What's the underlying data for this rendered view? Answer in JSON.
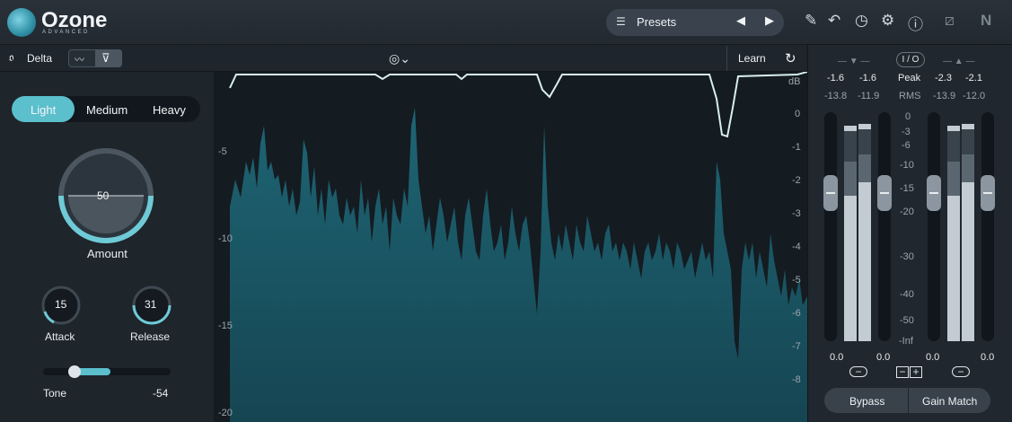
{
  "app": {
    "name": "Ozone",
    "edition": "ADVANCED"
  },
  "header": {
    "presets_label": "Presets",
    "icons": [
      "list-icon",
      "prev-arrow-icon",
      "next-arrow-icon",
      "pencil-icon",
      "undo-icon",
      "history-icon",
      "gear-icon",
      "help-icon",
      "signal-icon",
      "ni-logo"
    ]
  },
  "toolbar": {
    "delta_label": "Delta",
    "learn_label": "Learn"
  },
  "controls": {
    "modes": [
      "Light",
      "Medium",
      "Heavy"
    ],
    "selected_mode": "Light",
    "amount": {
      "label": "Amount",
      "value": "50"
    },
    "attack": {
      "label": "Attack",
      "value": "15"
    },
    "release": {
      "label": "Release",
      "value": "31"
    },
    "tone": {
      "label": "Tone",
      "value": "-54"
    }
  },
  "spectrum": {
    "db_unit": "dB",
    "left_scale": [
      "-5",
      "-10",
      "-15",
      "-20"
    ],
    "right_scale": [
      "0",
      "-1",
      "-2",
      "-3",
      "-4",
      "-5",
      "-6",
      "-7",
      "-8"
    ]
  },
  "meters": {
    "input": {
      "peak_l": "-1.6",
      "peak_r": "-1.6",
      "rms_l": "-13.8",
      "rms_r": "-11.9",
      "gain_l": "0.0",
      "gain_r": "0.0"
    },
    "output": {
      "peak_l": "-2.3",
      "peak_r": "-2.1",
      "rms_l": "-13.9",
      "rms_r": "-12.0",
      "gain_l": "0.0",
      "gain_r": "0.0"
    },
    "io_label": "I / O",
    "peak_label": "Peak",
    "rms_label": "RMS",
    "scale": [
      "0",
      "-3",
      "-6",
      "-10",
      "-15",
      "-20",
      "-30",
      "-40",
      "-50",
      "-Inf"
    ],
    "bypass_label": "Bypass",
    "gain_match_label": "Gain Match",
    "minus_label": "−",
    "plus_label": "+"
  },
  "colors": {
    "accent": "#5bbfcc",
    "spectrum_fill": "#1c5866",
    "curve": "#d8eef2"
  }
}
